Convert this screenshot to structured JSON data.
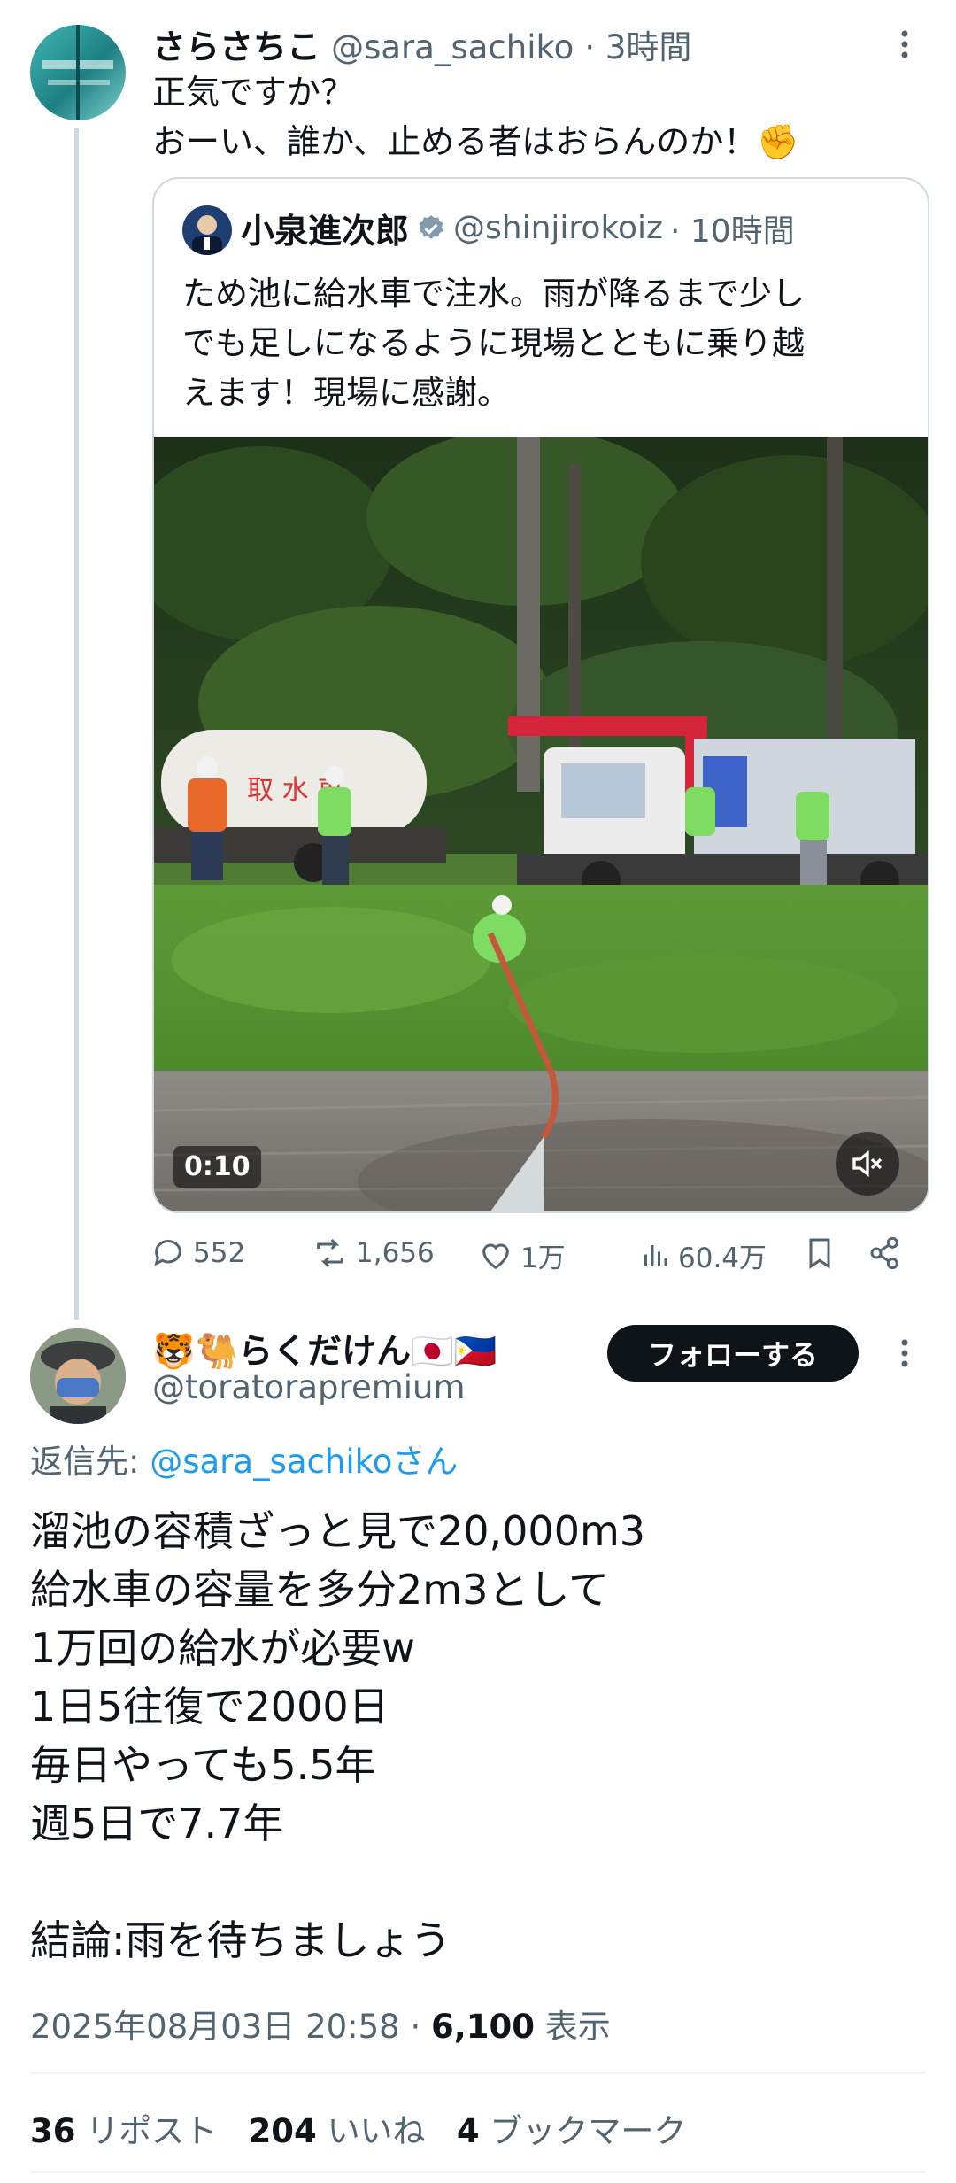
{
  "parent_tweet": {
    "display_name": "さらさちこ",
    "handle": "@sara_sachiko",
    "time": "· 3時間",
    "text_line1": "正気ですか？",
    "text_line2": "おーい、誰か、止める者はおらんのか！✊"
  },
  "quoted_tweet": {
    "display_name": "小泉進次郎",
    "handle": "@shinjirokoiz",
    "time": "· 10時間",
    "text_line1": "ため池に給水車で注水。雨が降るまで少し",
    "text_line2": "でも足しになるように現場とともに乗り越",
    "text_line3": "えます！現場に感謝。",
    "video_duration": "0:10",
    "truck_label": "取 水 車"
  },
  "parent_actions": {
    "replies": "552",
    "reposts": "1,656",
    "likes": "1万",
    "views": "60.4万"
  },
  "reply_tweet": {
    "display_name": "🐯🐫らくだけん🇯🇵🇵🇭",
    "handle": "@toratorapremium",
    "follow_label": "フォローする",
    "replying_to_prefix": "返信先: ",
    "replying_to_handle": "@sara_sachikoさん",
    "lines": [
      "溜池の容積ざっと見で20,000m3",
      "給水車の容量を多分2m3として",
      "1万回の給水が必要w",
      "1日5往復で2000日",
      "毎日やっても5.5年",
      "週5日で7.7年",
      "結論:雨を待ちましょう"
    ],
    "timestamp": "2025年08月03日 20:58 · ",
    "view_count": "6,100",
    "view_label": " 表示"
  },
  "stats": {
    "reposts_count": "36",
    "reposts_label": "リポスト",
    "likes_count": "204",
    "likes_label": "いいね",
    "bookmarks_count": "4",
    "bookmarks_label": "ブックマーク"
  },
  "colors": {
    "accent": "#1d9bf0",
    "secondary_text": "#536471",
    "follow_button": "#0f1419"
  }
}
